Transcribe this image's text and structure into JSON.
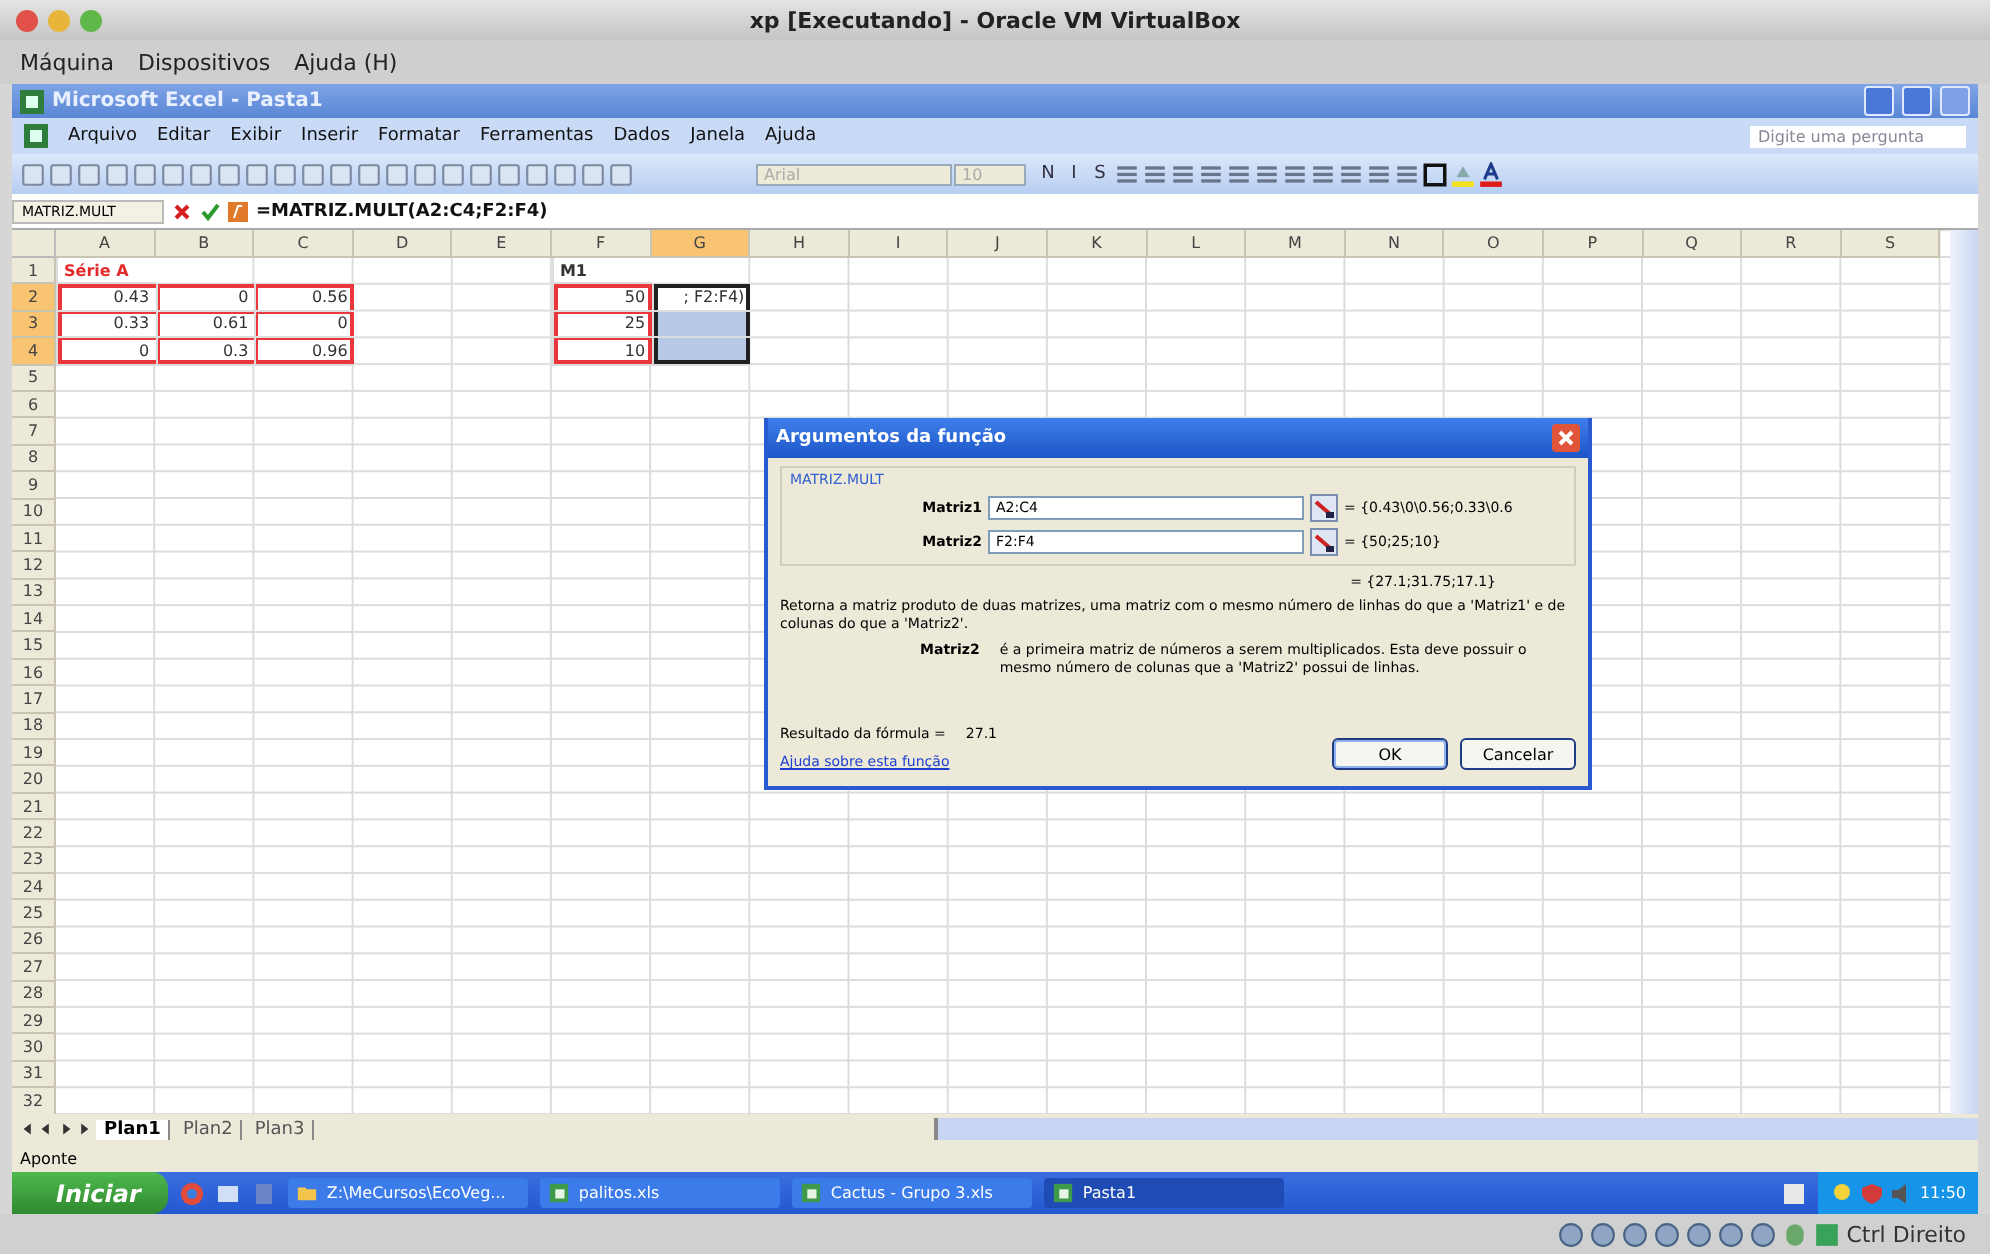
{
  "host_window": {
    "title": "xp [Executando] - Oracle VM VirtualBox",
    "menu": [
      "Máquina",
      "Dispositivos",
      "Ajuda (H)"
    ]
  },
  "excel": {
    "title": "Microsoft Excel - Pasta1",
    "menu": [
      "Arquivo",
      "Editar",
      "Exibir",
      "Inserir",
      "Formatar",
      "Ferramentas",
      "Dados",
      "Janela",
      "Ajuda"
    ],
    "question_placeholder": "Digite uma pergunta",
    "font_name": "Arial",
    "font_size": "10",
    "format_buttons": [
      "N",
      "I",
      "S"
    ]
  },
  "formula_bar": {
    "name_box": "MATRIZ.MULT",
    "formula": "=MATRIZ.MULT(A2:C4;F2:F4)"
  },
  "sheet": {
    "columns": [
      {
        "label": "A",
        "selected": false
      },
      {
        "label": "B",
        "selected": false
      },
      {
        "label": "C",
        "selected": false
      },
      {
        "label": "D",
        "selected": false
      },
      {
        "label": "E",
        "selected": false
      },
      {
        "label": "F",
        "selected": false
      },
      {
        "label": "G",
        "selected": true
      },
      {
        "label": "H",
        "selected": false
      },
      {
        "label": "I",
        "selected": false
      },
      {
        "label": "J",
        "selected": false
      },
      {
        "label": "K",
        "selected": false
      },
      {
        "label": "L",
        "selected": false
      },
      {
        "label": "M",
        "selected": false
      },
      {
        "label": "N",
        "selected": false
      },
      {
        "label": "O",
        "selected": false
      },
      {
        "label": "P",
        "selected": false
      },
      {
        "label": "Q",
        "selected": false
      },
      {
        "label": "R",
        "selected": false
      },
      {
        "label": "S",
        "selected": false
      }
    ],
    "rows": [
      {
        "number": "1",
        "selected": false,
        "cells": [
          {
            "text": "Série A",
            "kind": "title"
          },
          null,
          null,
          null,
          null,
          {
            "text": "M1",
            "kind": "title_plain"
          },
          null
        ]
      },
      {
        "number": "2",
        "selected": true,
        "cells": [
          {
            "text": "0.43",
            "color": "#e8383d"
          },
          {
            "text": "0",
            "color": "#e8383d"
          },
          {
            "text": "0.56",
            "color": "#e8383d"
          },
          null,
          null,
          {
            "text": "50",
            "color": "#e8383d"
          },
          {
            "text": "; F2:F4)",
            "selected": true,
            "active": true
          }
        ]
      },
      {
        "number": "3",
        "selected": true,
        "cells": [
          {
            "text": "0.33",
            "color": "#e8383d"
          },
          {
            "text": "0.61",
            "color": "#e8383d"
          },
          {
            "text": "0",
            "color": "#e8383d"
          },
          null,
          null,
          {
            "text": "25",
            "color": "#e8383d"
          },
          {
            "selected": true,
            "active": false
          }
        ]
      },
      {
        "number": "4",
        "selected": true,
        "cells": [
          {
            "text": "0",
            "color": "#e8383d"
          },
          {
            "text": "0.3",
            "color": "#e8383d"
          },
          {
            "text": "0.96",
            "color": "#e8383d"
          },
          null,
          null,
          {
            "text": "10",
            "color": "#e8383d"
          },
          {
            "selected": true,
            "active": false
          }
        ]
      },
      {
        "number": "5",
        "selected": false
      },
      {
        "number": "6",
        "selected": false
      },
      {
        "number": "7",
        "selected": false
      },
      {
        "number": "8",
        "selected": false
      },
      {
        "number": "9",
        "selected": false
      },
      {
        "number": "10",
        "selected": false
      },
      {
        "number": "11",
        "selected": false
      },
      {
        "number": "12",
        "selected": false
      },
      {
        "number": "13",
        "selected": false
      },
      {
        "number": "14",
        "selected": false
      },
      {
        "number": "15",
        "selected": false
      },
      {
        "number": "16",
        "selected": false
      },
      {
        "number": "17",
        "selected": false
      },
      {
        "number": "18",
        "selected": false
      },
      {
        "number": "19",
        "selected": false
      },
      {
        "number": "20",
        "selected": false
      },
      {
        "number": "21",
        "selected": false
      },
      {
        "number": "22",
        "selected": false
      },
      {
        "number": "23",
        "selected": false
      },
      {
        "number": "24",
        "selected": false
      },
      {
        "number": "25",
        "selected": false
      },
      {
        "number": "26",
        "selected": false
      },
      {
        "number": "27",
        "selected": false
      },
      {
        "number": "28",
        "selected": false
      },
      {
        "number": "29",
        "selected": false
      },
      {
        "number": "30",
        "selected": false
      },
      {
        "number": "31",
        "selected": false
      },
      {
        "number": "32",
        "selected": false
      }
    ],
    "tabs": [
      {
        "label": "Plan1",
        "selected": true
      },
      {
        "label": "Plan2",
        "selected": false
      },
      {
        "label": "Plan3",
        "selected": false
      }
    ],
    "status": "Aponte"
  },
  "dialog": {
    "title": "Argumentos da função",
    "function_name": "MATRIZ.MULT",
    "arguments": [
      {
        "label": "Matriz1",
        "value": "A2:C4",
        "result": "= {0.43\\0\\0.56;0.33\\0.6"
      },
      {
        "label": "Matriz2",
        "value": "F2:F4",
        "result": "= {50;25;10}"
      }
    ],
    "total": "= {27.1;31.75;17.1}",
    "description": "Retorna a matriz produto de duas matrizes, uma matriz com o mesmo número de linhas do que a 'Matriz1' e de colunas do que a 'Matriz2'.",
    "argument_help_label": "Matriz2",
    "argument_help": "é a primeira matriz de números a serem multiplicados. Esta deve possuir o mesmo número de colunas que a 'Matriz2' possui de linhas.",
    "result_label": "Resultado da fórmula =",
    "result_value": "27.1",
    "help_link": "Ajuda sobre esta função",
    "buttons": [
      "OK",
      "Cancelar"
    ]
  },
  "taskbar": {
    "start": "Iniciar",
    "tasks": [
      {
        "label": "Z:\\MeCursos\\EcoVeg...",
        "kind": "folder",
        "selected": false
      },
      {
        "label": "palitos.xls",
        "kind": "excel",
        "selected": false
      },
      {
        "label": "Cactus - Grupo 3.xls",
        "kind": "excel",
        "selected": false
      },
      {
        "label": "Pasta1",
        "kind": "excel",
        "selected": true
      }
    ],
    "clock": "11:50"
  },
  "host_status": {
    "host_key": "Ctrl Direito"
  }
}
